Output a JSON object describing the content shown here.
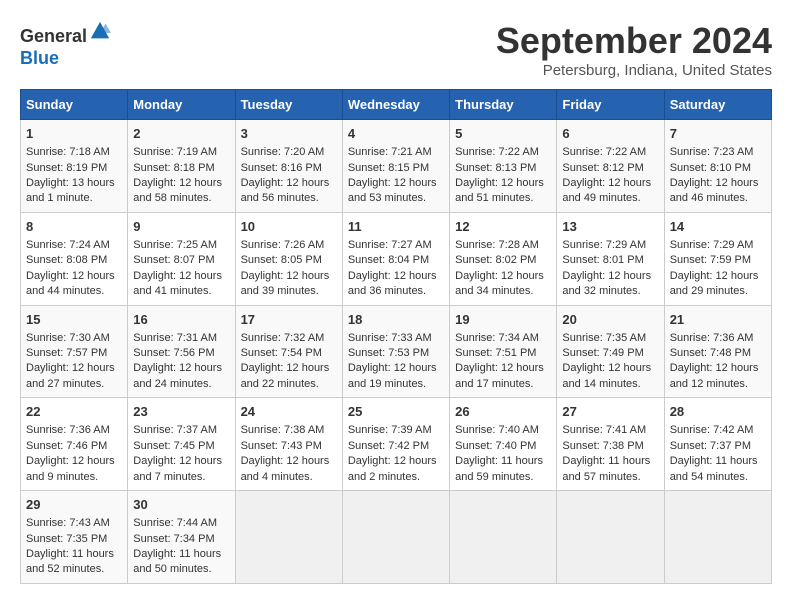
{
  "header": {
    "logo_line1": "General",
    "logo_line2": "Blue",
    "month": "September 2024",
    "location": "Petersburg, Indiana, United States"
  },
  "days_of_week": [
    "Sunday",
    "Monday",
    "Tuesday",
    "Wednesday",
    "Thursday",
    "Friday",
    "Saturday"
  ],
  "weeks": [
    [
      {
        "day": "1",
        "lines": [
          "Sunrise: 7:18 AM",
          "Sunset: 8:19 PM",
          "Daylight: 13 hours",
          "and 1 minute."
        ]
      },
      {
        "day": "2",
        "lines": [
          "Sunrise: 7:19 AM",
          "Sunset: 8:18 PM",
          "Daylight: 12 hours",
          "and 58 minutes."
        ]
      },
      {
        "day": "3",
        "lines": [
          "Sunrise: 7:20 AM",
          "Sunset: 8:16 PM",
          "Daylight: 12 hours",
          "and 56 minutes."
        ]
      },
      {
        "day": "4",
        "lines": [
          "Sunrise: 7:21 AM",
          "Sunset: 8:15 PM",
          "Daylight: 12 hours",
          "and 53 minutes."
        ]
      },
      {
        "day": "5",
        "lines": [
          "Sunrise: 7:22 AM",
          "Sunset: 8:13 PM",
          "Daylight: 12 hours",
          "and 51 minutes."
        ]
      },
      {
        "day": "6",
        "lines": [
          "Sunrise: 7:22 AM",
          "Sunset: 8:12 PM",
          "Daylight: 12 hours",
          "and 49 minutes."
        ]
      },
      {
        "day": "7",
        "lines": [
          "Sunrise: 7:23 AM",
          "Sunset: 8:10 PM",
          "Daylight: 12 hours",
          "and 46 minutes."
        ]
      }
    ],
    [
      {
        "day": "8",
        "lines": [
          "Sunrise: 7:24 AM",
          "Sunset: 8:08 PM",
          "Daylight: 12 hours",
          "and 44 minutes."
        ]
      },
      {
        "day": "9",
        "lines": [
          "Sunrise: 7:25 AM",
          "Sunset: 8:07 PM",
          "Daylight: 12 hours",
          "and 41 minutes."
        ]
      },
      {
        "day": "10",
        "lines": [
          "Sunrise: 7:26 AM",
          "Sunset: 8:05 PM",
          "Daylight: 12 hours",
          "and 39 minutes."
        ]
      },
      {
        "day": "11",
        "lines": [
          "Sunrise: 7:27 AM",
          "Sunset: 8:04 PM",
          "Daylight: 12 hours",
          "and 36 minutes."
        ]
      },
      {
        "day": "12",
        "lines": [
          "Sunrise: 7:28 AM",
          "Sunset: 8:02 PM",
          "Daylight: 12 hours",
          "and 34 minutes."
        ]
      },
      {
        "day": "13",
        "lines": [
          "Sunrise: 7:29 AM",
          "Sunset: 8:01 PM",
          "Daylight: 12 hours",
          "and 32 minutes."
        ]
      },
      {
        "day": "14",
        "lines": [
          "Sunrise: 7:29 AM",
          "Sunset: 7:59 PM",
          "Daylight: 12 hours",
          "and 29 minutes."
        ]
      }
    ],
    [
      {
        "day": "15",
        "lines": [
          "Sunrise: 7:30 AM",
          "Sunset: 7:57 PM",
          "Daylight: 12 hours",
          "and 27 minutes."
        ]
      },
      {
        "day": "16",
        "lines": [
          "Sunrise: 7:31 AM",
          "Sunset: 7:56 PM",
          "Daylight: 12 hours",
          "and 24 minutes."
        ]
      },
      {
        "day": "17",
        "lines": [
          "Sunrise: 7:32 AM",
          "Sunset: 7:54 PM",
          "Daylight: 12 hours",
          "and 22 minutes."
        ]
      },
      {
        "day": "18",
        "lines": [
          "Sunrise: 7:33 AM",
          "Sunset: 7:53 PM",
          "Daylight: 12 hours",
          "and 19 minutes."
        ]
      },
      {
        "day": "19",
        "lines": [
          "Sunrise: 7:34 AM",
          "Sunset: 7:51 PM",
          "Daylight: 12 hours",
          "and 17 minutes."
        ]
      },
      {
        "day": "20",
        "lines": [
          "Sunrise: 7:35 AM",
          "Sunset: 7:49 PM",
          "Daylight: 12 hours",
          "and 14 minutes."
        ]
      },
      {
        "day": "21",
        "lines": [
          "Sunrise: 7:36 AM",
          "Sunset: 7:48 PM",
          "Daylight: 12 hours",
          "and 12 minutes."
        ]
      }
    ],
    [
      {
        "day": "22",
        "lines": [
          "Sunrise: 7:36 AM",
          "Sunset: 7:46 PM",
          "Daylight: 12 hours",
          "and 9 minutes."
        ]
      },
      {
        "day": "23",
        "lines": [
          "Sunrise: 7:37 AM",
          "Sunset: 7:45 PM",
          "Daylight: 12 hours",
          "and 7 minutes."
        ]
      },
      {
        "day": "24",
        "lines": [
          "Sunrise: 7:38 AM",
          "Sunset: 7:43 PM",
          "Daylight: 12 hours",
          "and 4 minutes."
        ]
      },
      {
        "day": "25",
        "lines": [
          "Sunrise: 7:39 AM",
          "Sunset: 7:42 PM",
          "Daylight: 12 hours",
          "and 2 minutes."
        ]
      },
      {
        "day": "26",
        "lines": [
          "Sunrise: 7:40 AM",
          "Sunset: 7:40 PM",
          "Daylight: 11 hours",
          "and 59 minutes."
        ]
      },
      {
        "day": "27",
        "lines": [
          "Sunrise: 7:41 AM",
          "Sunset: 7:38 PM",
          "Daylight: 11 hours",
          "and 57 minutes."
        ]
      },
      {
        "day": "28",
        "lines": [
          "Sunrise: 7:42 AM",
          "Sunset: 7:37 PM",
          "Daylight: 11 hours",
          "and 54 minutes."
        ]
      }
    ],
    [
      {
        "day": "29",
        "lines": [
          "Sunrise: 7:43 AM",
          "Sunset: 7:35 PM",
          "Daylight: 11 hours",
          "and 52 minutes."
        ]
      },
      {
        "day": "30",
        "lines": [
          "Sunrise: 7:44 AM",
          "Sunset: 7:34 PM",
          "Daylight: 11 hours",
          "and 50 minutes."
        ]
      },
      {
        "day": "",
        "lines": []
      },
      {
        "day": "",
        "lines": []
      },
      {
        "day": "",
        "lines": []
      },
      {
        "day": "",
        "lines": []
      },
      {
        "day": "",
        "lines": []
      }
    ]
  ]
}
